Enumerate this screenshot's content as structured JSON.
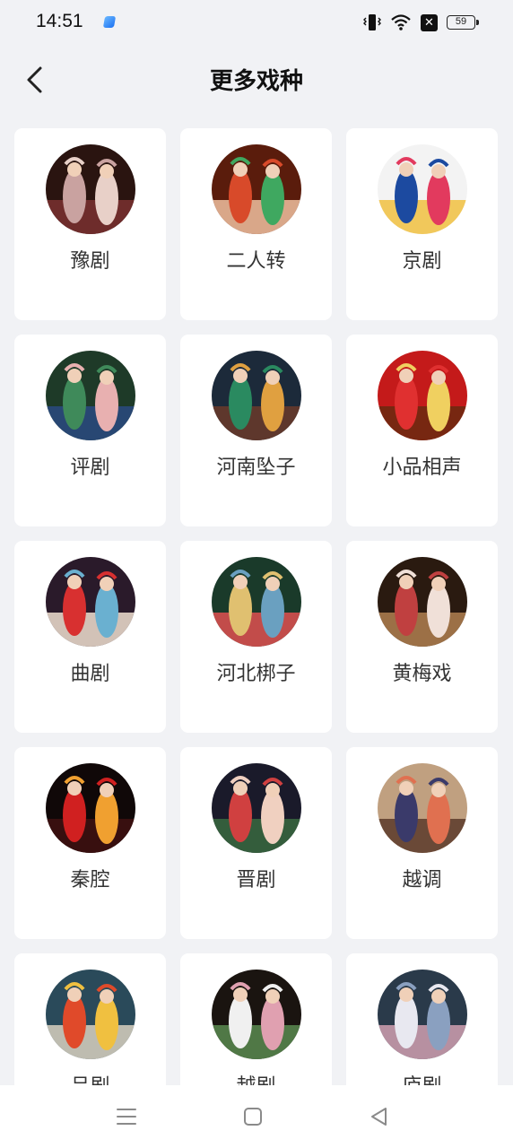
{
  "status_bar": {
    "time": "14:51",
    "battery_level": "59",
    "icons": [
      "app-notification-icon",
      "vibrate-icon",
      "wifi-icon",
      "close-box-icon",
      "battery-icon"
    ]
  },
  "header": {
    "title": "更多戏种",
    "back_icon": "chevron-left-icon"
  },
  "genres": [
    {
      "label": "豫剧",
      "palette": [
        "#2a1410",
        "#c9a2a0",
        "#e8d0c8",
        "#7a3030"
      ]
    },
    {
      "label": "二人转",
      "palette": [
        "#5a1c0c",
        "#d84a2a",
        "#3fa860",
        "#f0c0a0"
      ]
    },
    {
      "label": "京剧",
      "palette": [
        "#f3f3f3",
        "#1c4aa0",
        "#e23a5e",
        "#f0c040"
      ]
    },
    {
      "label": "评剧",
      "palette": [
        "#1e3a28",
        "#3f8a5a",
        "#e8b0b0",
        "#2a4a80"
      ]
    },
    {
      "label": "河南坠子",
      "palette": [
        "#1c2a3a",
        "#2a8a60",
        "#e0a040",
        "#6a3a2a"
      ]
    },
    {
      "label": "小品相声",
      "palette": [
        "#c41a1a",
        "#e03030",
        "#f0d060",
        "#6a2a10"
      ]
    },
    {
      "label": "曲剧",
      "palette": [
        "#2a1a2a",
        "#d83030",
        "#6ab0d0",
        "#f0e0d0"
      ]
    },
    {
      "label": "河北梆子",
      "palette": [
        "#1a3a2a",
        "#e0c070",
        "#6aa0c0",
        "#e05050"
      ]
    },
    {
      "label": "黄梅戏",
      "palette": [
        "#2a1a10",
        "#c04040",
        "#f0e0d8",
        "#b08050"
      ]
    },
    {
      "label": "秦腔",
      "palette": [
        "#100808",
        "#d02020",
        "#f0a030",
        "#401010"
      ]
    },
    {
      "label": "晋剧",
      "palette": [
        "#1a1a2a",
        "#d04040",
        "#f0d0c0",
        "#3a6a40"
      ]
    },
    {
      "label": "越调",
      "palette": [
        "#c0a080",
        "#3a3a6a",
        "#e07050",
        "#5a3a2a"
      ]
    },
    {
      "label": "吕剧",
      "palette": [
        "#2a4a5a",
        "#e04a2a",
        "#f0c040",
        "#d8d0c0"
      ]
    },
    {
      "label": "越剧",
      "palette": [
        "#1a1410",
        "#f0f0f0",
        "#e0a0b0",
        "#5a8a50"
      ]
    },
    {
      "label": "庐剧",
      "palette": [
        "#2a3a4a",
        "#e8e8f0",
        "#8aa0c0",
        "#d0a0b0"
      ]
    }
  ],
  "nav_bar": {
    "icons": [
      "menu-icon",
      "home-square-icon",
      "back-triangle-icon"
    ]
  }
}
